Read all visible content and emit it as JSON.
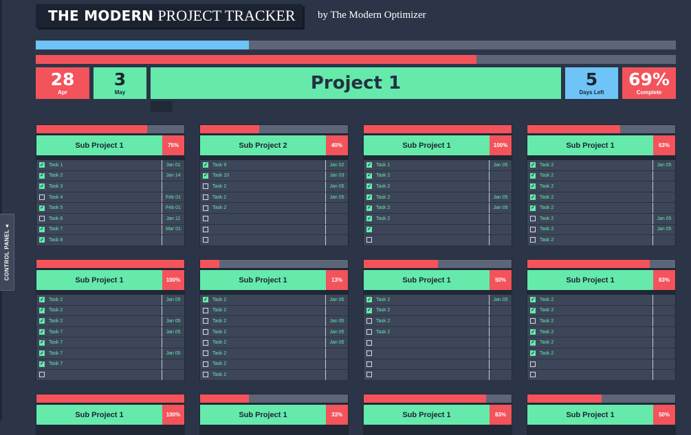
{
  "header": {
    "title_bold": "THE MODERN",
    "title_light": "PROJECT TRACKER",
    "byline": "by The Modern Optimizer"
  },
  "progress": {
    "time_elapsed_fraction": 0.333,
    "completion_fraction": 0.688
  },
  "summary": {
    "start_day": "28",
    "start_month": "Apr",
    "end_day": "3",
    "end_month": "May",
    "project_name": "Project 1",
    "days_left": "5",
    "days_left_label": "Days Left",
    "complete_pct": "69%",
    "complete_label": "Complete"
  },
  "control_panel": {
    "label": "CONTROL PANEL ◂"
  },
  "colors": {
    "accent_green": "#65eaac",
    "accent_red": "#f3535b",
    "accent_blue": "#6ec4f7",
    "background": "#2b3547"
  },
  "cards": [
    {
      "name": "Sub Project 1",
      "pct": "75%",
      "progress": 0.75,
      "tasks": [
        {
          "checked": true,
          "task": "Task 1",
          "date": "Jan 01"
        },
        {
          "checked": true,
          "task": "Task 2",
          "date": "Jan 14"
        },
        {
          "checked": true,
          "task": "Task 3",
          "date": ""
        },
        {
          "checked": false,
          "task": "Task 4",
          "date": "Feb 01"
        },
        {
          "checked": true,
          "task": "Task 5",
          "date": "Feb 01"
        },
        {
          "checked": false,
          "task": "Task 6",
          "date": "Jan 11"
        },
        {
          "checked": true,
          "task": "Task 7",
          "date": "Mar 01"
        },
        {
          "checked": true,
          "task": "Task 8",
          "date": ""
        }
      ]
    },
    {
      "name": "Sub Project 2",
      "pct": "40%",
      "progress": 0.4,
      "tasks": [
        {
          "checked": true,
          "task": "Task 9",
          "date": "Jan 02"
        },
        {
          "checked": true,
          "task": "Task 10",
          "date": "Jan 03"
        },
        {
          "checked": false,
          "task": "Task 2",
          "date": "Jan 05"
        },
        {
          "checked": false,
          "task": "Task 2",
          "date": "Jan 05"
        },
        {
          "checked": false,
          "task": "Task 2",
          "date": ""
        },
        {
          "checked": false,
          "task": "",
          "date": ""
        },
        {
          "checked": false,
          "task": "",
          "date": ""
        },
        {
          "checked": false,
          "task": "",
          "date": ""
        }
      ]
    },
    {
      "name": "Sub Project 1",
      "pct": "100%",
      "progress": 1.0,
      "tasks": [
        {
          "checked": true,
          "task": "Task 1",
          "date": "Jan 05"
        },
        {
          "checked": true,
          "task": "Task 2",
          "date": ""
        },
        {
          "checked": true,
          "task": "Task 2",
          "date": ""
        },
        {
          "checked": true,
          "task": "Task 2",
          "date": "Jan 05"
        },
        {
          "checked": true,
          "task": "Task 2",
          "date": "Jan 05"
        },
        {
          "checked": true,
          "task": "Task 2",
          "date": ""
        },
        {
          "checked": true,
          "task": "",
          "date": ""
        },
        {
          "checked": false,
          "task": "",
          "date": ""
        }
      ]
    },
    {
      "name": "Sub Project 1",
      "pct": "63%",
      "progress": 0.63,
      "tasks": [
        {
          "checked": true,
          "task": "Task 2",
          "date": "Jan 05"
        },
        {
          "checked": true,
          "task": "Task 2",
          "date": ""
        },
        {
          "checked": true,
          "task": "Task 2",
          "date": ""
        },
        {
          "checked": true,
          "task": "Task 2",
          "date": ""
        },
        {
          "checked": true,
          "task": "Task 2",
          "date": ""
        },
        {
          "checked": false,
          "task": "Task 2",
          "date": "Jan 05"
        },
        {
          "checked": false,
          "task": "Task 2",
          "date": "Jan 05"
        },
        {
          "checked": false,
          "task": "Task 2",
          "date": ""
        }
      ]
    },
    {
      "name": "Sub Project 1",
      "pct": "100%",
      "progress": 1.0,
      "tasks": [
        {
          "checked": true,
          "task": "Task 2",
          "date": "Jan 05"
        },
        {
          "checked": true,
          "task": "Task 2",
          "date": ""
        },
        {
          "checked": true,
          "task": "Task 2",
          "date": "Jan 05"
        },
        {
          "checked": true,
          "task": "Task 7",
          "date": "Jan 05"
        },
        {
          "checked": true,
          "task": "Task 7",
          "date": ""
        },
        {
          "checked": true,
          "task": "Task 7",
          "date": "Jan 05"
        },
        {
          "checked": true,
          "task": "Task 7",
          "date": ""
        },
        {
          "checked": false,
          "task": "",
          "date": ""
        }
      ]
    },
    {
      "name": "Sub Project 1",
      "pct": "13%",
      "progress": 0.13,
      "tasks": [
        {
          "checked": true,
          "task": "Task 2",
          "date": "Jan 05"
        },
        {
          "checked": false,
          "task": "Task 2",
          "date": ""
        },
        {
          "checked": false,
          "task": "Task 2",
          "date": "Jan 05"
        },
        {
          "checked": false,
          "task": "Task 2",
          "date": "Jan 05"
        },
        {
          "checked": false,
          "task": "Task 2",
          "date": "Jan 05"
        },
        {
          "checked": false,
          "task": "Task 2",
          "date": ""
        },
        {
          "checked": false,
          "task": "Task 2",
          "date": ""
        },
        {
          "checked": false,
          "task": "Task 2",
          "date": ""
        }
      ]
    },
    {
      "name": "Sub Project 1",
      "pct": "50%",
      "progress": 0.5,
      "tasks": [
        {
          "checked": true,
          "task": "Task 2",
          "date": "Jan 05"
        },
        {
          "checked": true,
          "task": "Task 2",
          "date": ""
        },
        {
          "checked": false,
          "task": "Task 2",
          "date": ""
        },
        {
          "checked": false,
          "task": "Task 2",
          "date": ""
        },
        {
          "checked": false,
          "task": "",
          "date": ""
        },
        {
          "checked": false,
          "task": "",
          "date": ""
        },
        {
          "checked": false,
          "task": "",
          "date": ""
        },
        {
          "checked": false,
          "task": "",
          "date": ""
        }
      ]
    },
    {
      "name": "Sub Project 1",
      "pct": "83%",
      "progress": 0.83,
      "tasks": [
        {
          "checked": true,
          "task": "Task 2",
          "date": ""
        },
        {
          "checked": true,
          "task": "Task 2",
          "date": ""
        },
        {
          "checked": false,
          "task": "Task 2",
          "date": ""
        },
        {
          "checked": true,
          "task": "Task 2",
          "date": ""
        },
        {
          "checked": true,
          "task": "Task 2",
          "date": ""
        },
        {
          "checked": true,
          "task": "Task 2",
          "date": ""
        },
        {
          "checked": false,
          "task": "",
          "date": ""
        },
        {
          "checked": false,
          "task": "",
          "date": ""
        }
      ]
    },
    {
      "name": "Sub Project 1",
      "pct": "100%",
      "progress": 1.0,
      "tasks": []
    },
    {
      "name": "Sub Project 1",
      "pct": "33%",
      "progress": 0.33,
      "tasks": []
    },
    {
      "name": "Sub Project 1",
      "pct": "83%",
      "progress": 0.83,
      "tasks": []
    },
    {
      "name": "Sub Project 1",
      "pct": "50%",
      "progress": 0.5,
      "tasks": []
    }
  ]
}
